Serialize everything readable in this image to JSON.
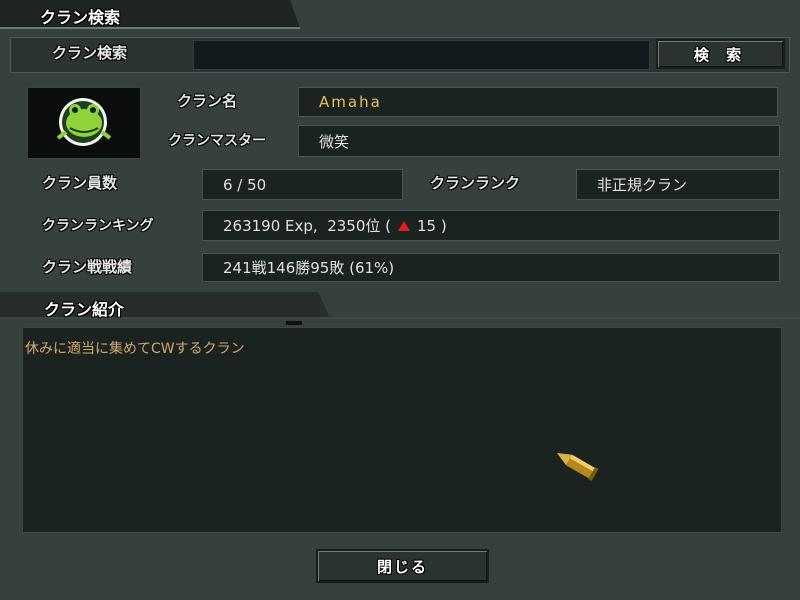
{
  "window": {
    "title": "クラン検索"
  },
  "search": {
    "label": "クラン検索",
    "input_value": "",
    "button_label": "検 索"
  },
  "clan": {
    "name_label": "クラン名",
    "name_value": "Amaha",
    "master_label": "クランマスター",
    "master_value": "微笑",
    "members_label": "クラン員数",
    "members_value": "6 / 50",
    "rank_label": "クランランク",
    "rank_value": "非正規クラン",
    "ranking_label": "クランランキング",
    "ranking_value": "263190 Exp,  2350位 (",
    "ranking_change": "15 )",
    "record_label": "クラン戦戦績",
    "record_value": "241戦146勝95敗 (61%)"
  },
  "intro": {
    "title": "クラン紹介",
    "text": "休みに適当に集めてCWするクラン"
  },
  "close_button": "閉じる",
  "colors": {
    "accent_name": "#e6c060",
    "intro_text": "#d2a86a",
    "rank_up": "#e02020"
  },
  "icons": {
    "emblem": "frog-emblem-icon",
    "rank_change": "red-up-triangle-icon",
    "cursor": "bullet-cursor-icon"
  }
}
